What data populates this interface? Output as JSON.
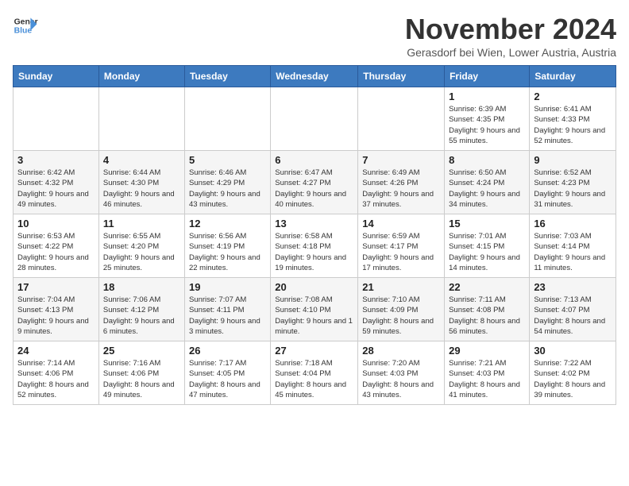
{
  "logo": {
    "line1": "General",
    "line2": "Blue"
  },
  "title": "November 2024",
  "location": "Gerasdorf bei Wien, Lower Austria, Austria",
  "headers": [
    "Sunday",
    "Monday",
    "Tuesday",
    "Wednesday",
    "Thursday",
    "Friday",
    "Saturday"
  ],
  "weeks": [
    [
      {
        "day": "",
        "info": ""
      },
      {
        "day": "",
        "info": ""
      },
      {
        "day": "",
        "info": ""
      },
      {
        "day": "",
        "info": ""
      },
      {
        "day": "",
        "info": ""
      },
      {
        "day": "1",
        "info": "Sunrise: 6:39 AM\nSunset: 4:35 PM\nDaylight: 9 hours and 55 minutes."
      },
      {
        "day": "2",
        "info": "Sunrise: 6:41 AM\nSunset: 4:33 PM\nDaylight: 9 hours and 52 minutes."
      }
    ],
    [
      {
        "day": "3",
        "info": "Sunrise: 6:42 AM\nSunset: 4:32 PM\nDaylight: 9 hours and 49 minutes."
      },
      {
        "day": "4",
        "info": "Sunrise: 6:44 AM\nSunset: 4:30 PM\nDaylight: 9 hours and 46 minutes."
      },
      {
        "day": "5",
        "info": "Sunrise: 6:46 AM\nSunset: 4:29 PM\nDaylight: 9 hours and 43 minutes."
      },
      {
        "day": "6",
        "info": "Sunrise: 6:47 AM\nSunset: 4:27 PM\nDaylight: 9 hours and 40 minutes."
      },
      {
        "day": "7",
        "info": "Sunrise: 6:49 AM\nSunset: 4:26 PM\nDaylight: 9 hours and 37 minutes."
      },
      {
        "day": "8",
        "info": "Sunrise: 6:50 AM\nSunset: 4:24 PM\nDaylight: 9 hours and 34 minutes."
      },
      {
        "day": "9",
        "info": "Sunrise: 6:52 AM\nSunset: 4:23 PM\nDaylight: 9 hours and 31 minutes."
      }
    ],
    [
      {
        "day": "10",
        "info": "Sunrise: 6:53 AM\nSunset: 4:22 PM\nDaylight: 9 hours and 28 minutes."
      },
      {
        "day": "11",
        "info": "Sunrise: 6:55 AM\nSunset: 4:20 PM\nDaylight: 9 hours and 25 minutes."
      },
      {
        "day": "12",
        "info": "Sunrise: 6:56 AM\nSunset: 4:19 PM\nDaylight: 9 hours and 22 minutes."
      },
      {
        "day": "13",
        "info": "Sunrise: 6:58 AM\nSunset: 4:18 PM\nDaylight: 9 hours and 19 minutes."
      },
      {
        "day": "14",
        "info": "Sunrise: 6:59 AM\nSunset: 4:17 PM\nDaylight: 9 hours and 17 minutes."
      },
      {
        "day": "15",
        "info": "Sunrise: 7:01 AM\nSunset: 4:15 PM\nDaylight: 9 hours and 14 minutes."
      },
      {
        "day": "16",
        "info": "Sunrise: 7:03 AM\nSunset: 4:14 PM\nDaylight: 9 hours and 11 minutes."
      }
    ],
    [
      {
        "day": "17",
        "info": "Sunrise: 7:04 AM\nSunset: 4:13 PM\nDaylight: 9 hours and 9 minutes."
      },
      {
        "day": "18",
        "info": "Sunrise: 7:06 AM\nSunset: 4:12 PM\nDaylight: 9 hours and 6 minutes."
      },
      {
        "day": "19",
        "info": "Sunrise: 7:07 AM\nSunset: 4:11 PM\nDaylight: 9 hours and 3 minutes."
      },
      {
        "day": "20",
        "info": "Sunrise: 7:08 AM\nSunset: 4:10 PM\nDaylight: 9 hours and 1 minute."
      },
      {
        "day": "21",
        "info": "Sunrise: 7:10 AM\nSunset: 4:09 PM\nDaylight: 8 hours and 59 minutes."
      },
      {
        "day": "22",
        "info": "Sunrise: 7:11 AM\nSunset: 4:08 PM\nDaylight: 8 hours and 56 minutes."
      },
      {
        "day": "23",
        "info": "Sunrise: 7:13 AM\nSunset: 4:07 PM\nDaylight: 8 hours and 54 minutes."
      }
    ],
    [
      {
        "day": "24",
        "info": "Sunrise: 7:14 AM\nSunset: 4:06 PM\nDaylight: 8 hours and 52 minutes."
      },
      {
        "day": "25",
        "info": "Sunrise: 7:16 AM\nSunset: 4:06 PM\nDaylight: 8 hours and 49 minutes."
      },
      {
        "day": "26",
        "info": "Sunrise: 7:17 AM\nSunset: 4:05 PM\nDaylight: 8 hours and 47 minutes."
      },
      {
        "day": "27",
        "info": "Sunrise: 7:18 AM\nSunset: 4:04 PM\nDaylight: 8 hours and 45 minutes."
      },
      {
        "day": "28",
        "info": "Sunrise: 7:20 AM\nSunset: 4:03 PM\nDaylight: 8 hours and 43 minutes."
      },
      {
        "day": "29",
        "info": "Sunrise: 7:21 AM\nSunset: 4:03 PM\nDaylight: 8 hours and 41 minutes."
      },
      {
        "day": "30",
        "info": "Sunrise: 7:22 AM\nSunset: 4:02 PM\nDaylight: 8 hours and 39 minutes."
      }
    ]
  ]
}
